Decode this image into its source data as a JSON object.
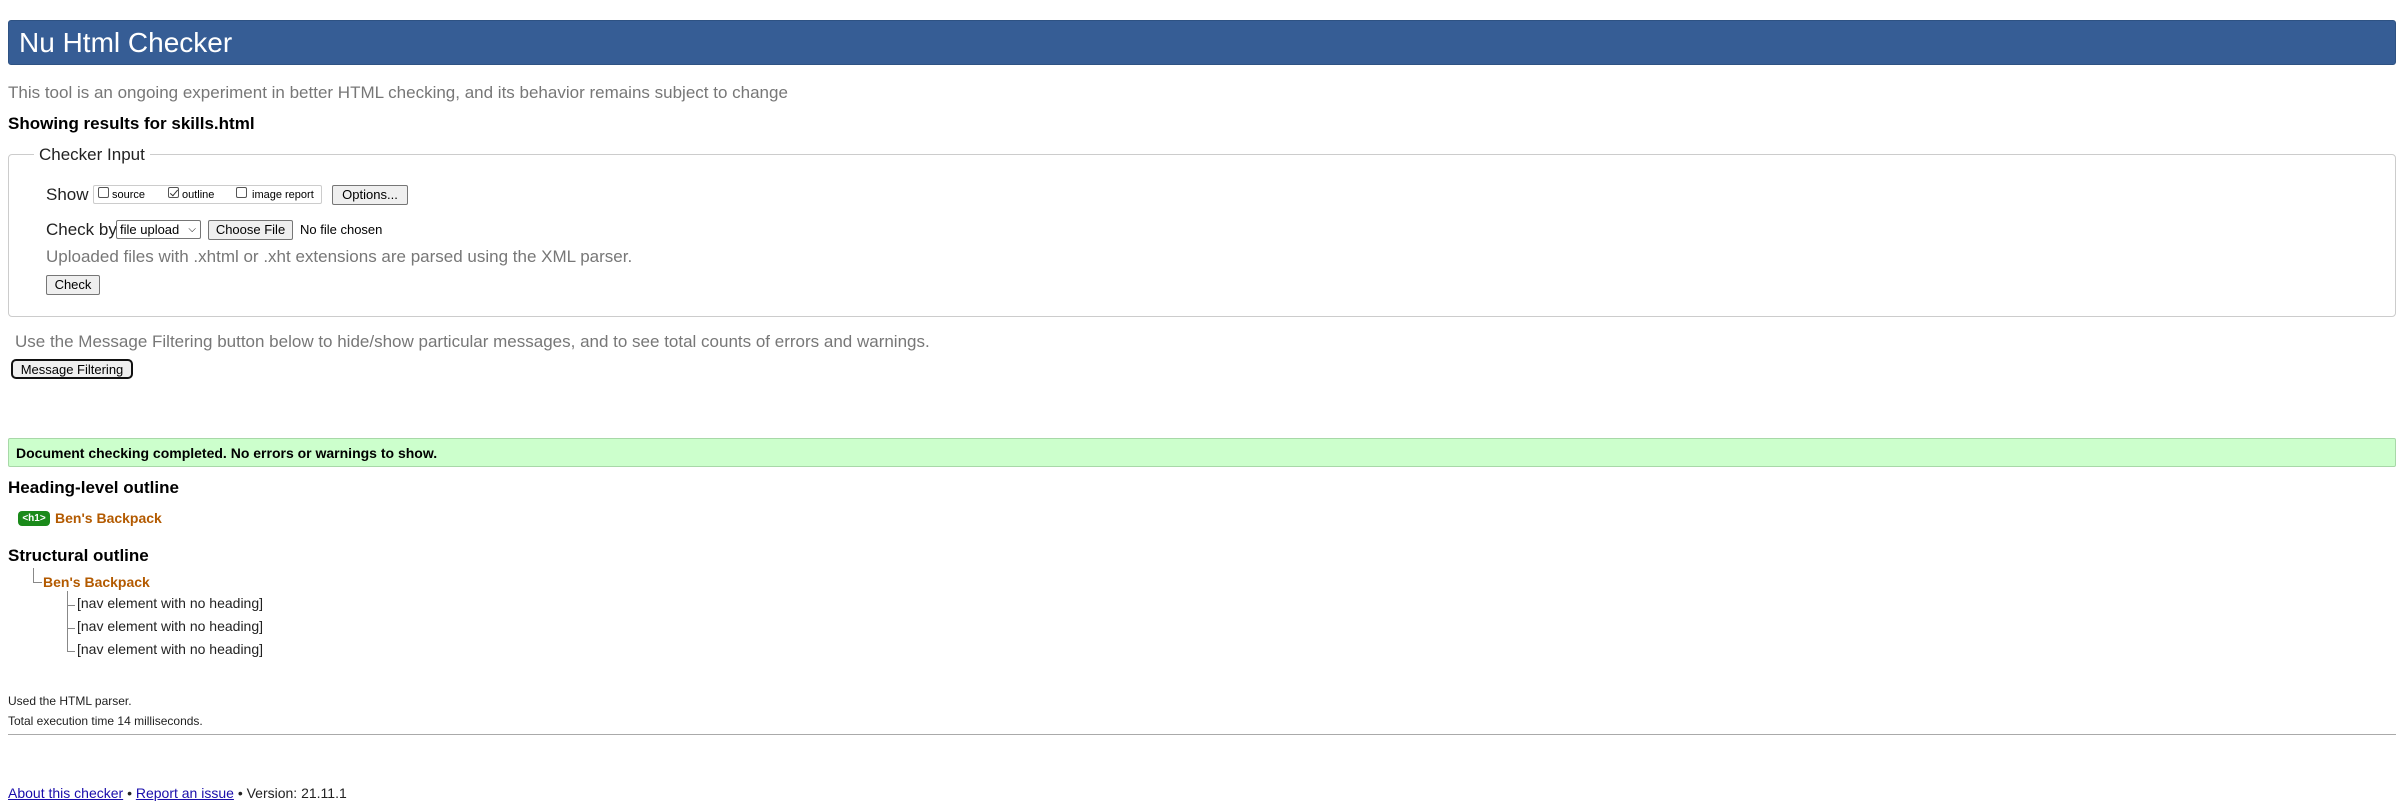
{
  "header": {
    "title": "Nu Html Checker"
  },
  "intro": {
    "experiment_note": "This tool is an ongoing experiment in better HTML checking, and its behavior remains subject to change",
    "showing_results": "Showing results for skills.html"
  },
  "checker_input": {
    "legend": "Checker Input",
    "show_label": "Show",
    "options": [
      {
        "label": "source",
        "checked": false
      },
      {
        "label": "outline",
        "checked": true
      },
      {
        "label": "image report",
        "checked": false
      }
    ],
    "options_button": "Options...",
    "check_by_label": "Check by",
    "check_by_value": "file upload",
    "choose_file_button": "Choose File",
    "no_file_text": "No file chosen",
    "upload_note": "Uploaded files with .xhtml or .xht extensions are parsed using the XML parser.",
    "check_button": "Check"
  },
  "filtering": {
    "note": "Use the Message Filtering button below to hide/show particular messages, and to see total counts of errors and warnings.",
    "button": "Message Filtering"
  },
  "result": {
    "message": "Document checking completed. No errors or warnings to show.",
    "color": "#ccffcc"
  },
  "heading_outline": {
    "title": "Heading-level outline",
    "tag": "<h1>",
    "heading": "Ben's Backpack"
  },
  "structural_outline": {
    "title": "Structural outline",
    "root": "Ben's Backpack",
    "items": [
      "[nav element with no heading]",
      "[nav element with no heading]",
      "[nav element with no heading]"
    ]
  },
  "stats": {
    "parser": "Used the HTML parser.",
    "time": "Total execution time 14 milliseconds."
  },
  "footer": {
    "about_link": "About this checker",
    "separator": "•",
    "report_link": "Report an issue",
    "version": "Version: 21.11.1"
  },
  "colors": {
    "banner": "#365d95",
    "heading_text": "#b35a00",
    "tag_bg": "#1a8a1a"
  }
}
